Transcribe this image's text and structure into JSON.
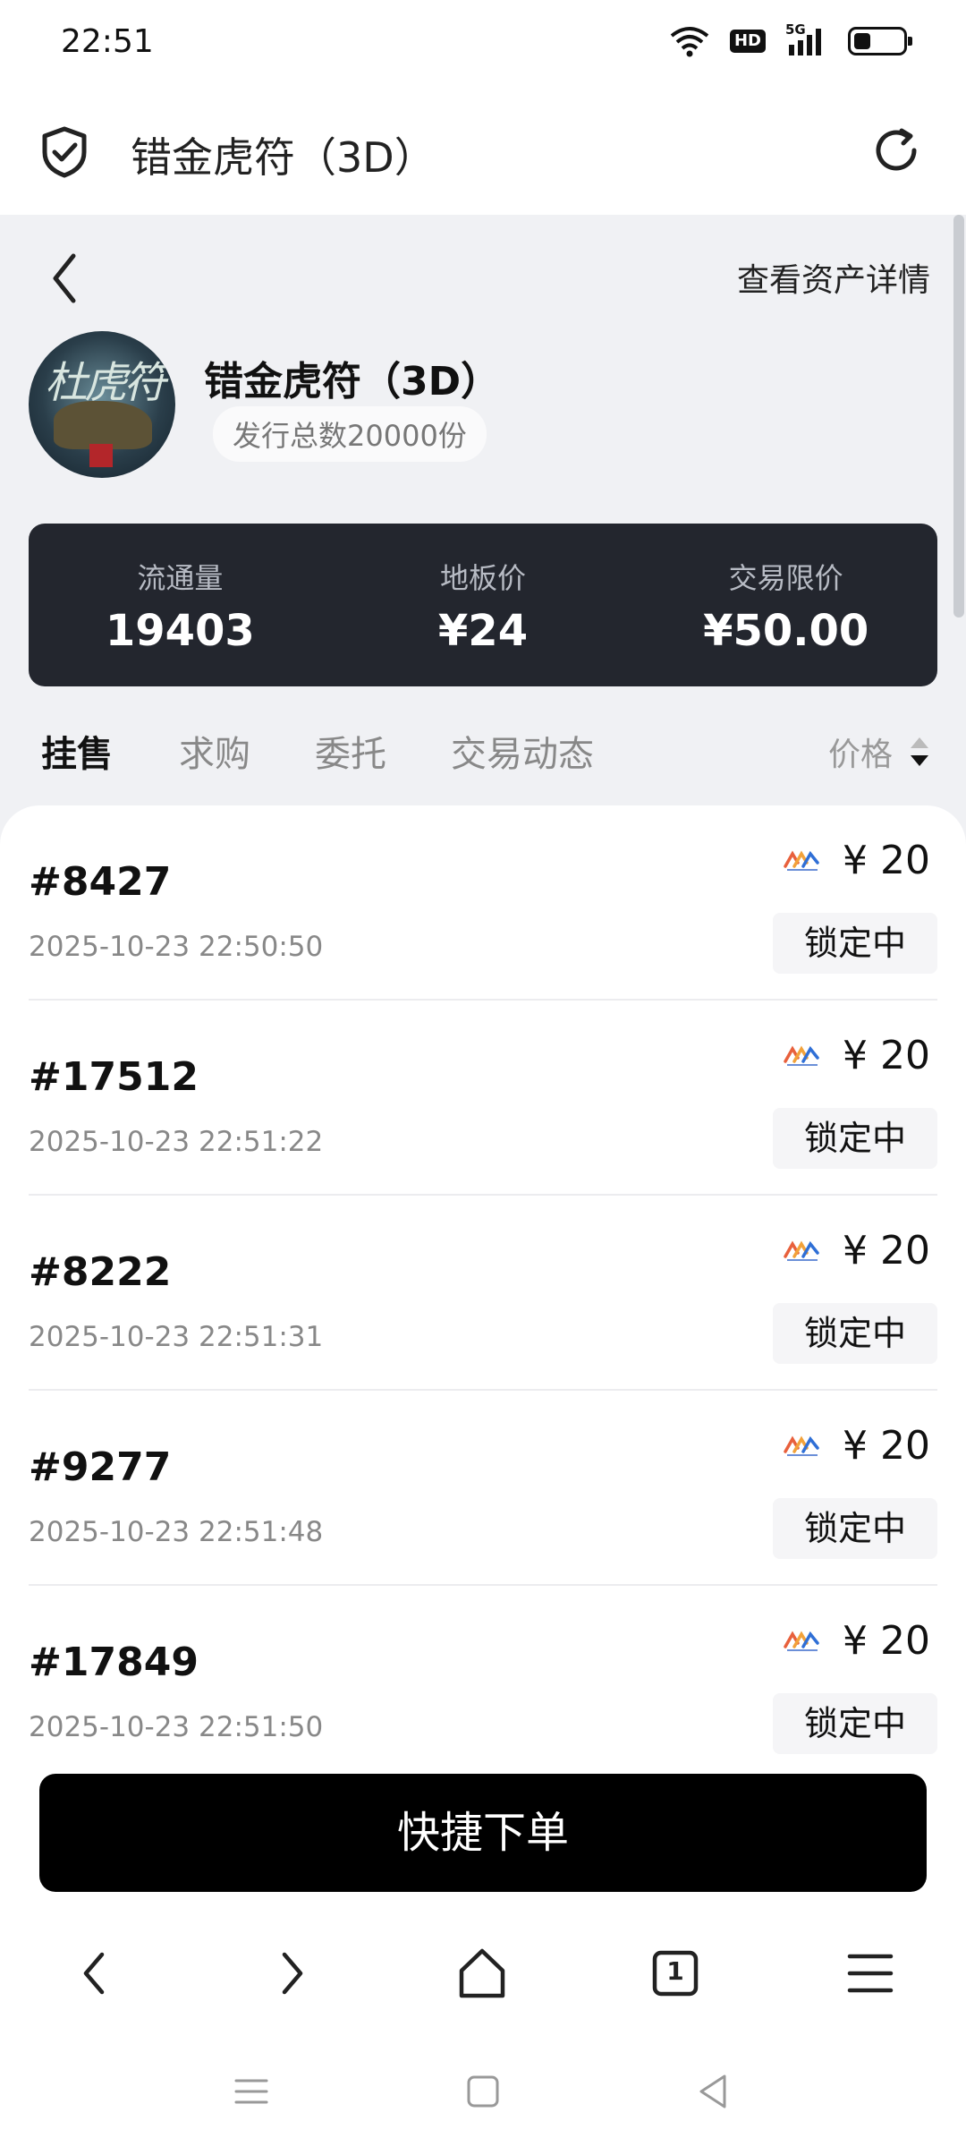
{
  "status_bar": {
    "time": "22:51",
    "hd_label": "HD",
    "network_label": "5G",
    "battery_level": 0.35
  },
  "browser": {
    "title": "错金虎符（3D）"
  },
  "header": {
    "asset_link": "查看资产详情"
  },
  "collection": {
    "avatar_text": "杜虎符",
    "name": "错金虎符（3D）",
    "supply": "发行总数20000份"
  },
  "stats": [
    {
      "label": "流通量",
      "value": "19403"
    },
    {
      "label": "地板价",
      "value": "¥24"
    },
    {
      "label": "交易限价",
      "value": "¥50.00"
    }
  ],
  "tabs": [
    {
      "label": "挂售",
      "active": true
    },
    {
      "label": "求购",
      "active": false
    },
    {
      "label": "委托",
      "active": false
    },
    {
      "label": "交易动态",
      "active": false
    }
  ],
  "sort": {
    "label": "价格"
  },
  "listings": [
    {
      "id": "#8427",
      "time": "2025-10-23 22:50:50",
      "price": "¥ 20",
      "status": "锁定中"
    },
    {
      "id": "#17512",
      "time": "2025-10-23 22:51:22",
      "price": "¥ 20",
      "status": "锁定中"
    },
    {
      "id": "#8222",
      "time": "2025-10-23 22:51:31",
      "price": "¥ 20",
      "status": "锁定中"
    },
    {
      "id": "#9277",
      "time": "2025-10-23 22:51:48",
      "price": "¥ 20",
      "status": "锁定中"
    },
    {
      "id": "#17849",
      "time": "2025-10-23 22:51:50",
      "price": "¥ 20",
      "status": "锁定中"
    }
  ],
  "cta": {
    "label": "快捷下单"
  },
  "toolbar": {
    "tab_count": "1"
  },
  "colors": {
    "card_bg": "#23262e",
    "page_bg": "#f0f1f4",
    "cta_bg": "#000000"
  }
}
